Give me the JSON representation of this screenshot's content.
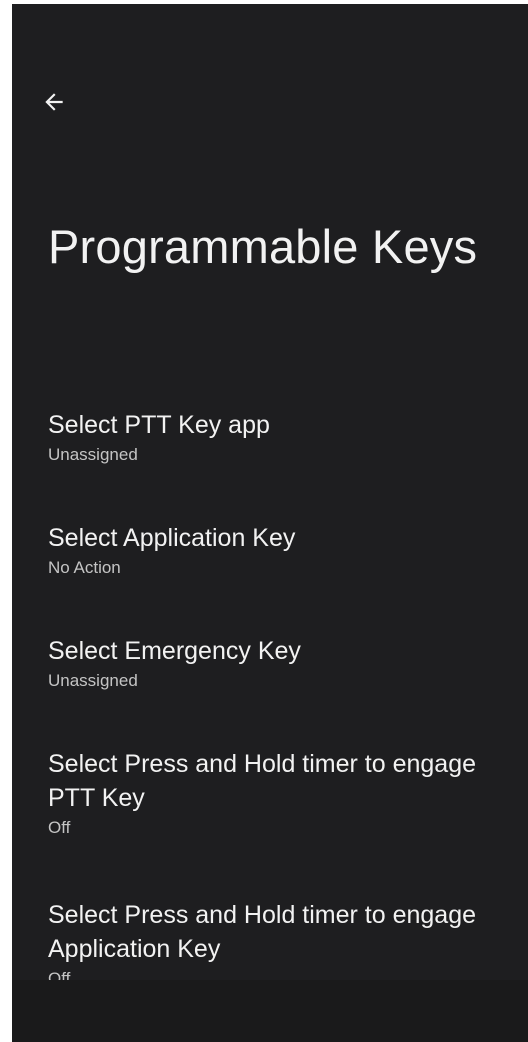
{
  "header": {
    "back_icon": "arrow-back-icon",
    "title": "Programmable Keys"
  },
  "settings": [
    {
      "title": "Select PTT Key app",
      "summary": "Unassigned"
    },
    {
      "title": "Select Application Key",
      "summary": "No Action"
    },
    {
      "title": "Select Emergency Key",
      "summary": "Unassigned"
    },
    {
      "title": "Select Press and Hold timer to engage PTT Key",
      "summary": "Off"
    },
    {
      "title": "Select Press and Hold timer to engage Application Key",
      "summary": "Off"
    }
  ],
  "colors": {
    "background": "#1e1e20",
    "primary_text": "#f2f2f2",
    "secondary_text": "#c4c4c4"
  }
}
